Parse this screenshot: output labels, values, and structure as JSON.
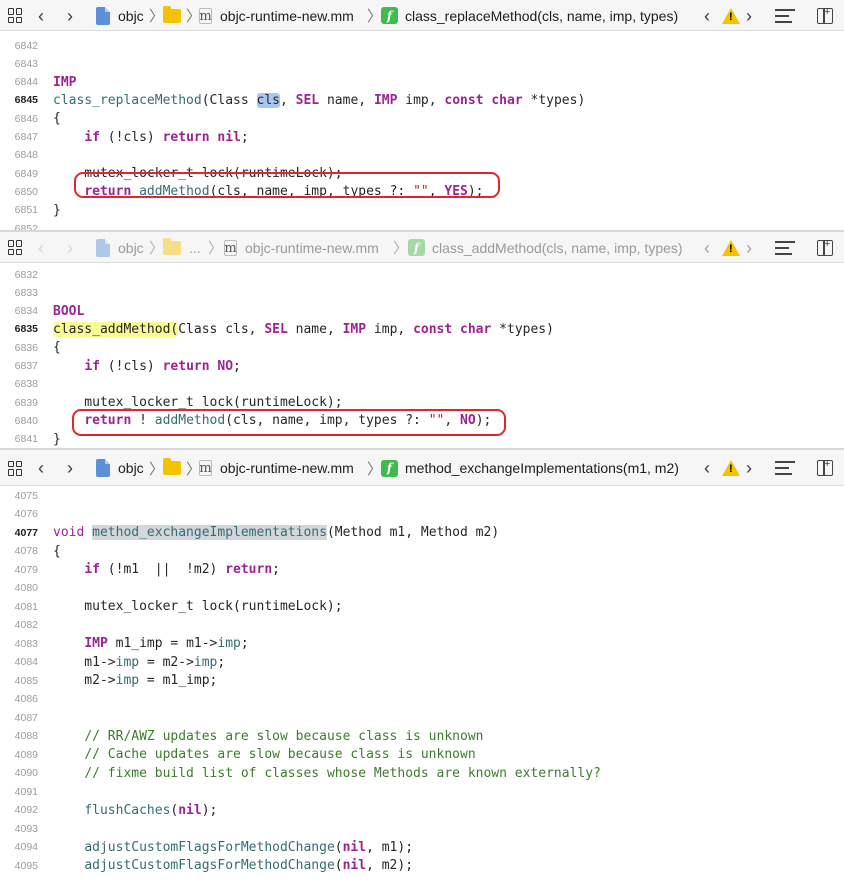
{
  "colors": {
    "keyword": "#9b2393",
    "function": "#326d74",
    "string": "#c41a16",
    "comment": "#3c7c2c",
    "callout": "#e0272b",
    "warning": "#f7c100",
    "func_badge": "#3fba4c"
  },
  "panes": [
    {
      "active": true,
      "jumpbar": {
        "project": "objc",
        "file": "objc-runtime-new.mm",
        "symbol": "class_replaceMethod(cls, name, imp, types)",
        "icons": [
          "related-items-icon",
          "back-icon",
          "forward-icon",
          "project-file-icon",
          "folder-icon",
          "source-file-icon",
          "function-icon",
          "warning-icon",
          "minimap-icon",
          "split-editor-icon"
        ]
      },
      "lines": [
        {
          "no": "6842",
          "tokens": []
        },
        {
          "no": "6843",
          "tokens": []
        },
        {
          "no": "6844",
          "tokens": [
            {
              "t": "IMP",
              "c": "kw"
            }
          ]
        },
        {
          "no": "6845",
          "current": true,
          "tokens": [
            {
              "t": "class_replaceMethod",
              "c": "fn"
            },
            {
              "t": "(Class "
            },
            {
              "t": "cls",
              "c": "hl-sel"
            },
            {
              "t": ", "
            },
            {
              "t": "SEL",
              "c": "kw"
            },
            {
              "t": " name, "
            },
            {
              "t": "IMP",
              "c": "kw"
            },
            {
              "t": " imp, "
            },
            {
              "t": "const",
              "c": "kw"
            },
            {
              "t": " "
            },
            {
              "t": "char",
              "c": "kw"
            },
            {
              "t": " *types)"
            }
          ]
        },
        {
          "no": "6846",
          "tokens": [
            {
              "t": "{"
            }
          ]
        },
        {
          "no": "6847",
          "tokens": [
            {
              "t": "    "
            },
            {
              "t": "if",
              "c": "kw"
            },
            {
              "t": " (!cls) "
            },
            {
              "t": "return",
              "c": "kw"
            },
            {
              "t": " "
            },
            {
              "t": "nil",
              "c": "kw"
            },
            {
              "t": ";"
            }
          ]
        },
        {
          "no": "6848",
          "tokens": []
        },
        {
          "no": "6849",
          "tokens": [
            {
              "t": "    mutex_locker_t lock(runtimeLock);"
            }
          ]
        },
        {
          "no": "6850",
          "tokens": [
            {
              "t": "    "
            },
            {
              "t": "return",
              "c": "kw"
            },
            {
              "t": " "
            },
            {
              "t": "addMethod",
              "c": "fn"
            },
            {
              "t": "(cls, name, imp, types ?: "
            },
            {
              "t": "\"\"",
              "c": "str"
            },
            {
              "t": ", "
            },
            {
              "t": "YES",
              "c": "kw"
            },
            {
              "t": ");"
            }
          ]
        },
        {
          "no": "6851",
          "tokens": [
            {
              "t": "}"
            }
          ]
        },
        {
          "no": "6852",
          "tokens": []
        }
      ]
    },
    {
      "active": false,
      "jumpbar": {
        "project": "objc",
        "folder": "...",
        "file": "objc-runtime-new.mm",
        "symbol": "class_addMethod(cls, name, imp, types)"
      },
      "lines": [
        {
          "no": "6832",
          "tokens": []
        },
        {
          "no": "6833",
          "tokens": []
        },
        {
          "no": "6834",
          "tokens": [
            {
              "t": "BOOL",
              "c": "kw"
            }
          ]
        },
        {
          "no": "6835",
          "current": true,
          "tokens": [
            {
              "t": "class_addMethod(",
              "c": "hl-yel"
            },
            {
              "t": "Class cls, "
            },
            {
              "t": "SEL",
              "c": "kw"
            },
            {
              "t": " name, "
            },
            {
              "t": "IMP",
              "c": "kw"
            },
            {
              "t": " imp, "
            },
            {
              "t": "const",
              "c": "kw"
            },
            {
              "t": " "
            },
            {
              "t": "char",
              "c": "kw"
            },
            {
              "t": " *types)"
            }
          ]
        },
        {
          "no": "6836",
          "tokens": [
            {
              "t": "{"
            }
          ]
        },
        {
          "no": "6837",
          "tokens": [
            {
              "t": "    "
            },
            {
              "t": "if",
              "c": "kw"
            },
            {
              "t": " (!cls) "
            },
            {
              "t": "return",
              "c": "kw"
            },
            {
              "t": " "
            },
            {
              "t": "NO",
              "c": "kw"
            },
            {
              "t": ";"
            }
          ]
        },
        {
          "no": "6838",
          "tokens": []
        },
        {
          "no": "6839",
          "tokens": [
            {
              "t": "    mutex_locker_t lock(runtimeLock);"
            }
          ]
        },
        {
          "no": "6840",
          "tokens": [
            {
              "t": "    "
            },
            {
              "t": "return",
              "c": "kw"
            },
            {
              "t": " ! "
            },
            {
              "t": "addMethod",
              "c": "fn"
            },
            {
              "t": "(cls, name, imp, types ?: "
            },
            {
              "t": "\"\"",
              "c": "str"
            },
            {
              "t": ", "
            },
            {
              "t": "NO",
              "c": "kw"
            },
            {
              "t": ");"
            }
          ]
        },
        {
          "no": "6841",
          "tokens": [
            {
              "t": "}"
            }
          ]
        }
      ]
    },
    {
      "active": true,
      "jumpbar": {
        "project": "objc",
        "file": "objc-runtime-new.mm",
        "symbol": "method_exchangeImplementations(m1, m2)"
      },
      "lines": [
        {
          "no": "4075",
          "tokens": []
        },
        {
          "no": "4076",
          "tokens": []
        },
        {
          "no": "4077",
          "current": true,
          "tokens": [
            {
              "t": "void",
              "c": "kw2"
            },
            {
              "t": " "
            },
            {
              "t": "method_exchangeImplementations",
              "c": "fn hl-grey"
            },
            {
              "t": "(Method m1, Method m2)"
            }
          ]
        },
        {
          "no": "4078",
          "tokens": [
            {
              "t": "{"
            }
          ]
        },
        {
          "no": "4079",
          "tokens": [
            {
              "t": "    "
            },
            {
              "t": "if",
              "c": "kw"
            },
            {
              "t": " (!m1  ||  !m2) "
            },
            {
              "t": "return",
              "c": "kw"
            },
            {
              "t": ";"
            }
          ]
        },
        {
          "no": "4080",
          "tokens": []
        },
        {
          "no": "4081",
          "tokens": [
            {
              "t": "    mutex_locker_t lock(runtimeLock);"
            }
          ]
        },
        {
          "no": "4082",
          "tokens": []
        },
        {
          "no": "4083",
          "tokens": [
            {
              "t": "    "
            },
            {
              "t": "IMP",
              "c": "kw"
            },
            {
              "t": " m1_imp = m1->"
            },
            {
              "t": "imp",
              "c": "fn"
            },
            {
              "t": ";"
            }
          ]
        },
        {
          "no": "4084",
          "tokens": [
            {
              "t": "    m1->"
            },
            {
              "t": "imp",
              "c": "fn"
            },
            {
              "t": " = m2->"
            },
            {
              "t": "imp",
              "c": "fn"
            },
            {
              "t": ";"
            }
          ]
        },
        {
          "no": "4085",
          "tokens": [
            {
              "t": "    m2->"
            },
            {
              "t": "imp",
              "c": "fn"
            },
            {
              "t": " = m1_imp;"
            }
          ]
        },
        {
          "no": "4086",
          "tokens": []
        },
        {
          "no": "4087",
          "tokens": []
        },
        {
          "no": "4088",
          "tokens": [
            {
              "t": "    "
            },
            {
              "t": "// RR/AWZ updates are slow because class is unknown",
              "c": "cmt"
            }
          ]
        },
        {
          "no": "4089",
          "tokens": [
            {
              "t": "    "
            },
            {
              "t": "// Cache updates are slow because class is unknown",
              "c": "cmt"
            }
          ]
        },
        {
          "no": "4090",
          "tokens": [
            {
              "t": "    "
            },
            {
              "t": "// fixme build list of classes whose Methods are known externally?",
              "c": "cmt"
            }
          ]
        },
        {
          "no": "4091",
          "tokens": []
        },
        {
          "no": "4092",
          "tokens": [
            {
              "t": "    "
            },
            {
              "t": "flushCaches",
              "c": "fn"
            },
            {
              "t": "("
            },
            {
              "t": "nil",
              "c": "kw"
            },
            {
              "t": ");"
            }
          ]
        },
        {
          "no": "4093",
          "tokens": []
        },
        {
          "no": "4094",
          "tokens": [
            {
              "t": "    "
            },
            {
              "t": "adjustCustomFlagsForMethodChange",
              "c": "fn"
            },
            {
              "t": "("
            },
            {
              "t": "nil",
              "c": "kw"
            },
            {
              "t": ", m1);"
            }
          ]
        },
        {
          "no": "4095",
          "tokens": [
            {
              "t": "    "
            },
            {
              "t": "adjustCustomFlagsForMethodChange",
              "c": "fn"
            },
            {
              "t": "("
            },
            {
              "t": "nil",
              "c": "kw"
            },
            {
              "t": ", m2);"
            }
          ]
        }
      ]
    }
  ]
}
